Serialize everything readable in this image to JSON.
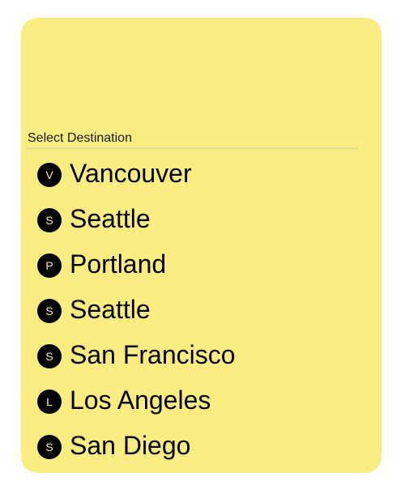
{
  "header": {
    "label": "Select Destination"
  },
  "destinations": [
    {
      "initial": "V",
      "name": "Vancouver"
    },
    {
      "initial": "S",
      "name": "Seattle"
    },
    {
      "initial": "P",
      "name": "Portland"
    },
    {
      "initial": "S",
      "name": "Seattle"
    },
    {
      "initial": "S",
      "name": "San Francisco"
    },
    {
      "initial": "L",
      "name": "Los Angeles"
    },
    {
      "initial": "S",
      "name": "San Diego"
    }
  ],
  "colors": {
    "card_background": "#f9ed82",
    "badge_background": "#000000",
    "badge_text": "#f9ed82"
  }
}
